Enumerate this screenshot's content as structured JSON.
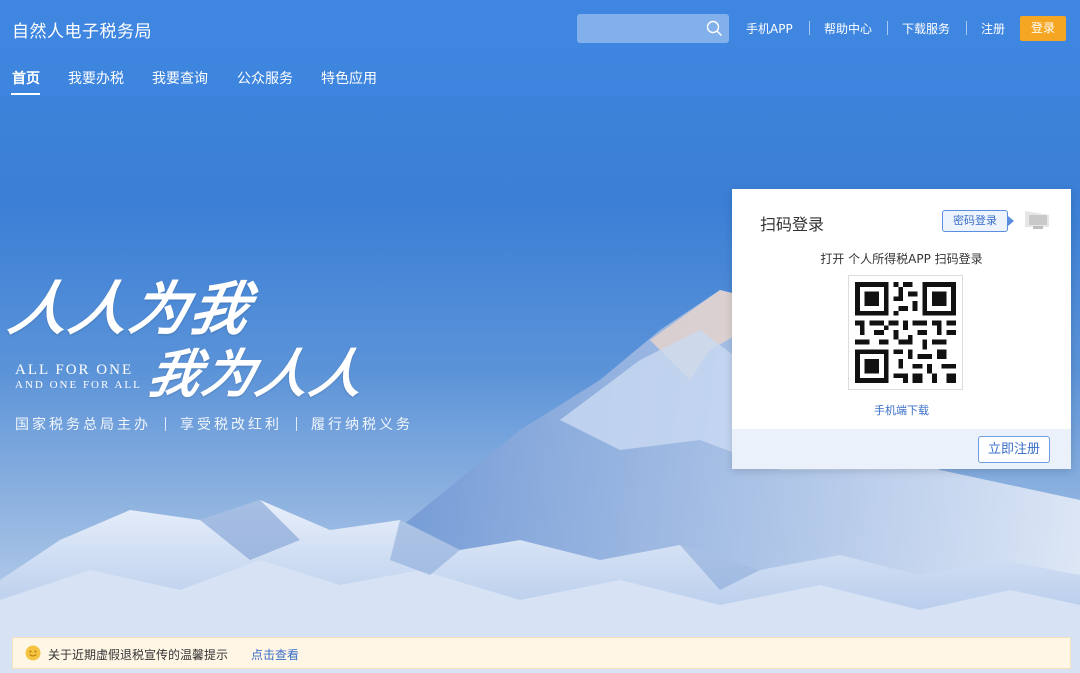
{
  "header": {
    "site_title": "自然人电子税务局",
    "search_placeholder": "",
    "links": [
      "手机APP",
      "帮助中心",
      "下载服务",
      "注册"
    ],
    "login_label": "登录"
  },
  "nav": {
    "items": [
      "首页",
      "我要办税",
      "我要查询",
      "公众服务",
      "特色应用"
    ],
    "active": "首页"
  },
  "slogan": {
    "line1": "人人为我",
    "line2": "我为人人",
    "en_line1": "ALL FOR ONE",
    "en_line2": "AND ONE FOR ALL",
    "tags": [
      "国家税务总局主办",
      "享受税改红利",
      "履行纳税义务"
    ]
  },
  "login_panel": {
    "title": "扫码登录",
    "password_tab": "密码登录",
    "scan_hint": "打开 个人所得税APP 扫码登录",
    "mobile_download": "手机端下载",
    "register_button": "立即注册"
  },
  "notice": {
    "text": "关于近期虚假退税宣传的温馨提示",
    "link": "点击查看"
  },
  "colors": {
    "header_blue": "#3d85de",
    "login_orange": "#f5a623",
    "link_blue": "#3a6fc8",
    "notice_bg": "#fff6e6"
  }
}
